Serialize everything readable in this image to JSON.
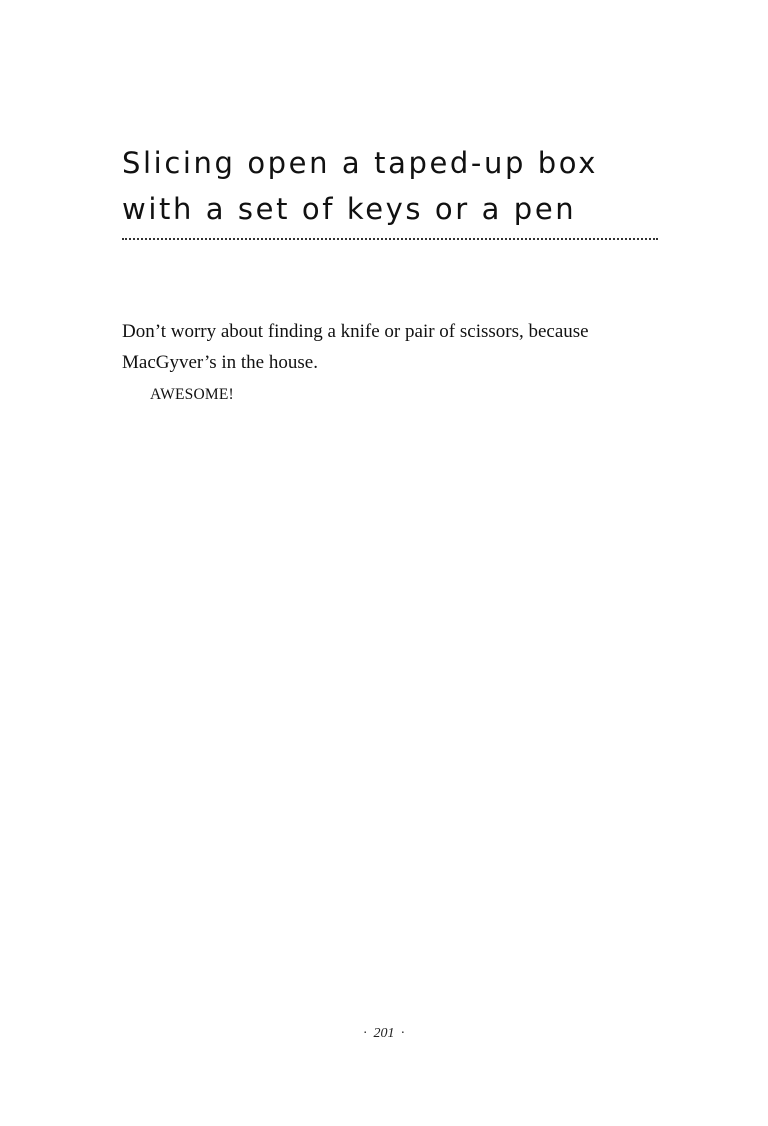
{
  "heading": {
    "line1": "Slicing open a taped-up box",
    "line2": "with a set of keys or a pen"
  },
  "body": {
    "paragraph_line1": "Don’t worry about finding a knife or pair of scissors, because",
    "paragraph_line2": "MacGyver’s in the house.",
    "exclamation": "AWESOME!"
  },
  "footer": {
    "page_number": "201"
  }
}
